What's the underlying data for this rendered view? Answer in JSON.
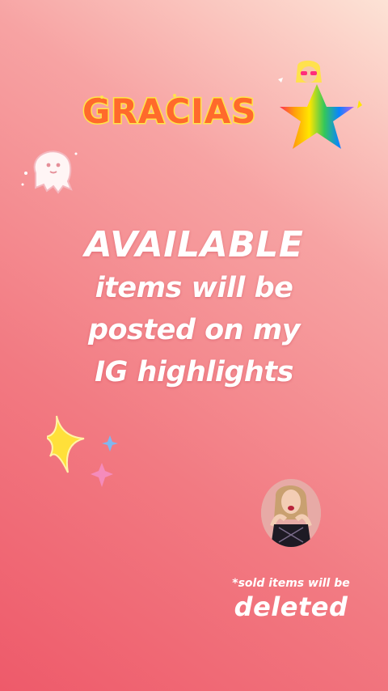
{
  "story": {
    "gracias_sticker": "GRACIAS",
    "headline": "AVAILABLE",
    "body_lines": [
      "items will be",
      "posted on my",
      "IG highlights"
    ],
    "sold_note": {
      "small": "*sold items will be",
      "big": "deleted"
    }
  },
  "icons": {
    "gracias": "gracias-sticker-icon",
    "ghost": "ghost-sticker-icon",
    "doll": "rainbow-doll-sticker-icon",
    "stars": "sparkle-stars-icon",
    "avatar": "person-gif-icon"
  },
  "colors": {
    "background_start": "#ee5a6a",
    "background_end": "#fde3d6",
    "text": "#ffffff",
    "gracias_fill": "#ff6a2b",
    "star_yellow": "#ffe03a",
    "star_blue": "#7fb7f0",
    "star_pink": "#f58bbb"
  }
}
